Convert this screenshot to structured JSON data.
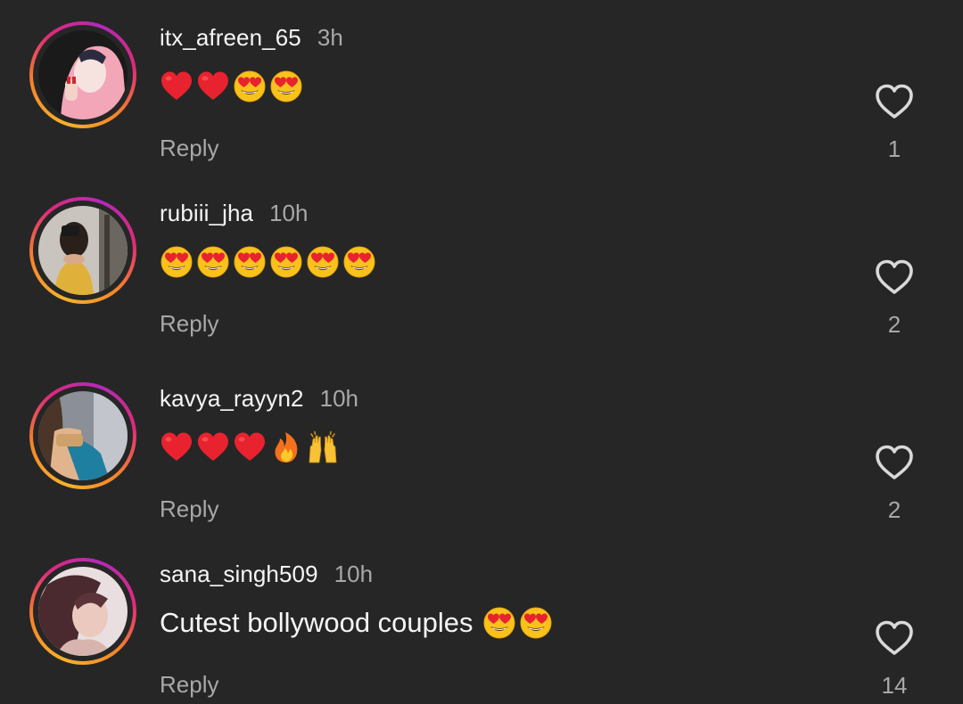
{
  "comments": [
    {
      "username": "itx_afreen_65",
      "time": "3h",
      "text": "",
      "emojis": [
        "heart",
        "heart",
        "heart-eyes",
        "heart-eyes"
      ],
      "reply_label": "Reply",
      "like_count": "1",
      "avatar_icon": "avatar-pink-hijab"
    },
    {
      "username": "rubiii_jha",
      "time": "10h",
      "text": "",
      "emojis": [
        "heart-eyes",
        "heart-eyes",
        "heart-eyes",
        "heart-eyes",
        "heart-eyes",
        "heart-eyes"
      ],
      "reply_label": "Reply",
      "like_count": "2",
      "avatar_icon": "avatar-mirror-selfie"
    },
    {
      "username": "kavya_rayyn2",
      "time": "10h",
      "text": "",
      "emojis": [
        "heart",
        "heart",
        "heart",
        "fire",
        "raising-hands"
      ],
      "reply_label": "Reply",
      "like_count": "2",
      "avatar_icon": "avatar-blue-saree"
    },
    {
      "username": "sana_singh509",
      "time": "10h",
      "text": "Cutest bollywood couples",
      "emojis": [
        "heart-eyes",
        "heart-eyes"
      ],
      "reply_label": "Reply",
      "like_count": "14",
      "avatar_icon": "avatar-portrait"
    }
  ],
  "colors": {
    "background": "#262626",
    "primary_text": "#f5f5f5",
    "secondary_text": "#a8a8a8",
    "story_ring_start": "#f7b32b",
    "story_ring_end": "#b22ab8"
  }
}
